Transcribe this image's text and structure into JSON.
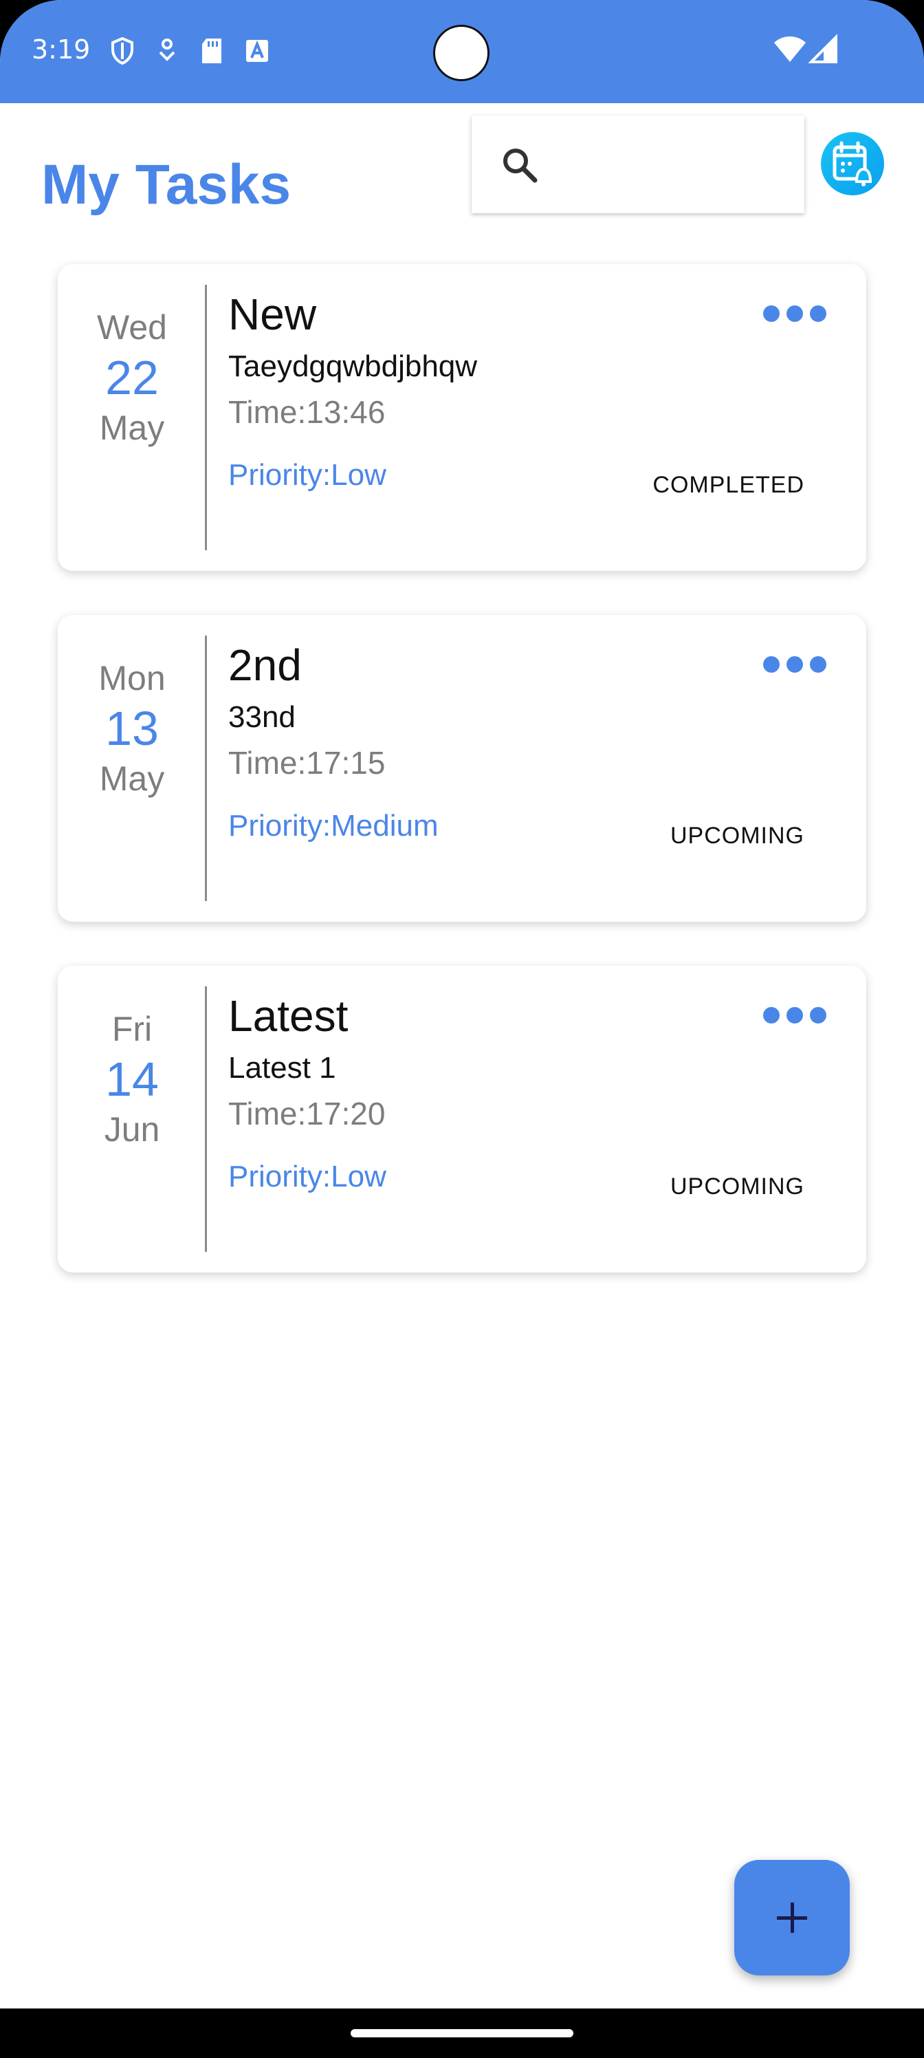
{
  "status_bar": {
    "time": "3:19",
    "icons": [
      "shield-icon",
      "download-indicator-icon",
      "sd-card-icon",
      "text-a-icon",
      "wifi-icon",
      "cellular-signal-icon"
    ]
  },
  "header": {
    "title": "My Tasks",
    "search_placeholder": "",
    "calendar_icon": "calendar-alarm-icon"
  },
  "colors": {
    "accent": "#4a86e8",
    "status_bar": "#4c87e8",
    "muted_text": "#7d7d7d",
    "calendar_button": "#0fb4f2"
  },
  "tasks": [
    {
      "dow": "Wed",
      "day": "22",
      "month": "May",
      "title": "New",
      "description": "Taeydgqwbdjbhqw",
      "time": "Time:13:46",
      "priority": "Priority:Low",
      "status": "COMPLETED"
    },
    {
      "dow": "Mon",
      "day": "13",
      "month": "May",
      "title": "2nd",
      "description": "33nd",
      "time": "Time:17:15",
      "priority": "Priority:Medium",
      "status": "UPCOMING"
    },
    {
      "dow": "Fri",
      "day": "14",
      "month": "Jun",
      "title": "Latest",
      "description": "Latest 1",
      "time": "Time:17:20",
      "priority": "Priority:Low",
      "status": "UPCOMING"
    }
  ],
  "fab": {
    "icon": "plus-icon"
  }
}
